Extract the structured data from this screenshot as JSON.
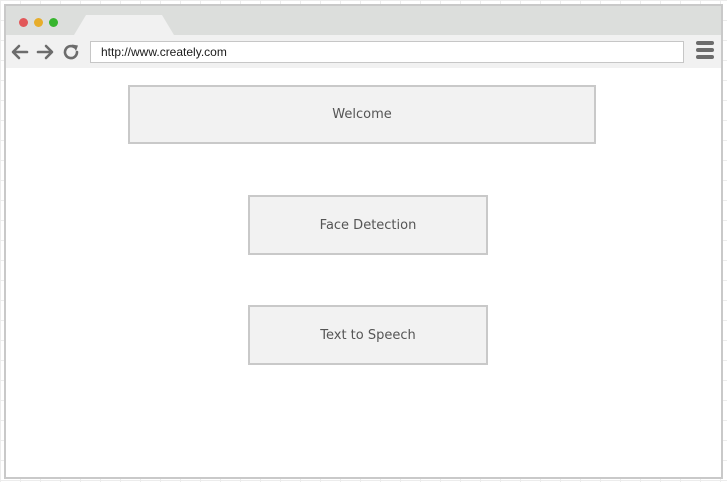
{
  "window": {
    "controls": [
      {
        "name": "close",
        "color": "#e2585a"
      },
      {
        "name": "minimize",
        "color": "#e7ad2b"
      },
      {
        "name": "maximize",
        "color": "#37b52e"
      }
    ]
  },
  "toolbar": {
    "back_icon": "arrow-left-icon",
    "forward_icon": "arrow-right-icon",
    "reload_icon": "reload-icon",
    "address": "http://www.creately.com",
    "menu_icon": "hamburger-menu-icon"
  },
  "main": {
    "buttons": [
      {
        "label": "Welcome"
      },
      {
        "label": "Face Detection"
      },
      {
        "label": "Text to Speech"
      }
    ]
  },
  "colors": {
    "chrome": "#dcdedc",
    "toolbar": "#f1f1f1",
    "box_fill": "#f2f2f2",
    "box_border": "#c9c9c9",
    "text": "#555555"
  }
}
